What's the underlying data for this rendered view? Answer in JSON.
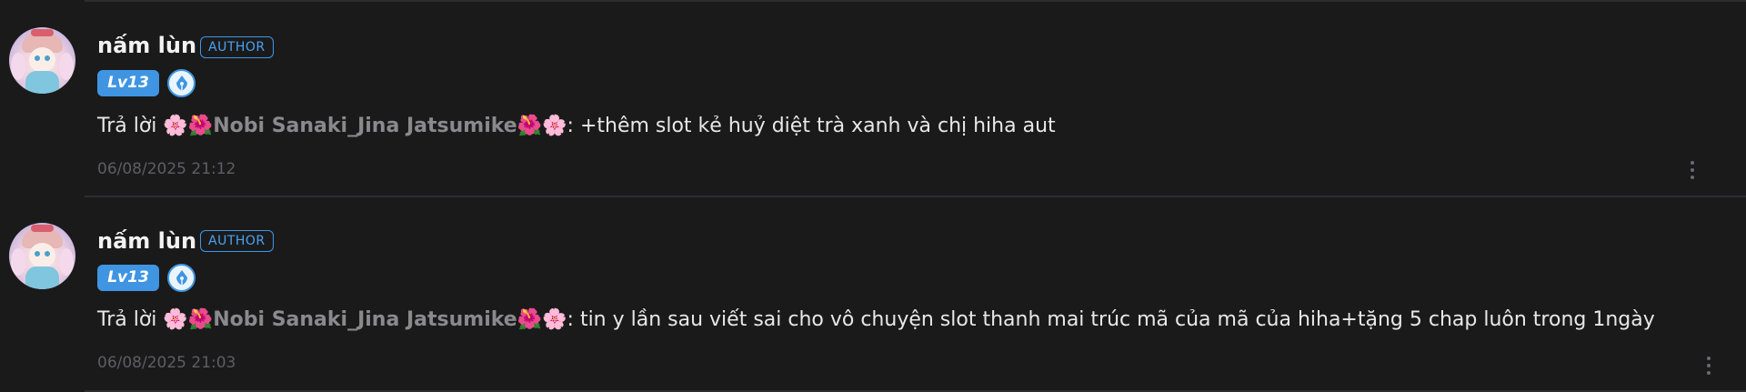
{
  "comments": [
    {
      "author": "nấm lùn",
      "author_badge": "AUTHOR",
      "level": "Lv13",
      "reply_prefix": "Trả lời",
      "mention": "Nobi Sanaki_Jina Jatsumike",
      "separator": ":",
      "text": "+thêm slot kẻ huỷ diệt trà xanh và chị hiha aut",
      "timestamp": "06/08/2025 21:12"
    },
    {
      "author": "nấm lùn",
      "author_badge": "AUTHOR",
      "level": "Lv13",
      "reply_prefix": "Trả lời",
      "mention": "Nobi Sanaki_Jina Jatsumike",
      "separator": ":",
      "text": "tin y lần sau viết sai cho vô chuyện slot thanh mai trúc mã của mã của hiha+tặng 5 chap luôn trong 1ngày",
      "timestamp": "06/08/2025 21:03"
    }
  ],
  "emoji": {
    "pink_flower": "🌸",
    "red_flower": "🌺"
  },
  "icons": {
    "more": "more-vertical-icon",
    "level_pen": "pen-nib-icon"
  },
  "colors": {
    "accent": "#3f95e2",
    "mention": "#8a8a8d",
    "background": "#1a1a1b"
  }
}
